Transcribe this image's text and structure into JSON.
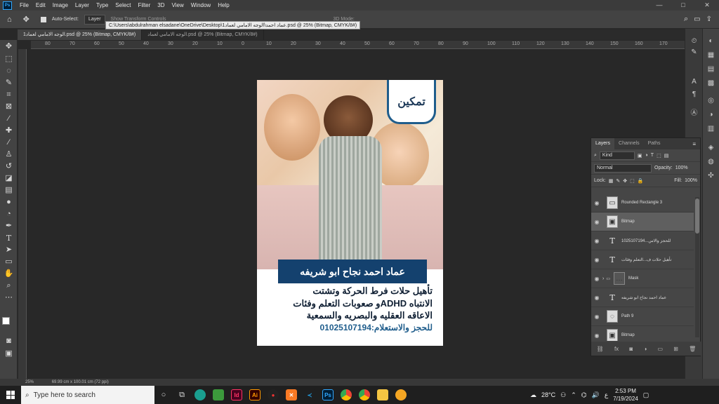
{
  "menu": {
    "app_icon": "Ps",
    "items": [
      "File",
      "Edit",
      "Image",
      "Layer",
      "Type",
      "Select",
      "Filter",
      "3D",
      "View",
      "Window",
      "Help"
    ],
    "window_controls": [
      "—",
      "□",
      "✕"
    ]
  },
  "options_bar": {
    "auto_select_label": "Auto-Select:",
    "auto_select_value": "Layer",
    "show_transform": "Show Transform Controls",
    "mode_3d": "3D Mode:"
  },
  "tooltip": "C:\\Users\\abdulrahman elsadane\\OneDrive\\Desktop\\عماد احمد\\الوجه الامامي لعماد1.psd @ 25% (Bitmap, CMYK/8#)",
  "tabs": [
    {
      "label": "الوجه الامامي لعماد1.psd @ 25% (Bitmap, CMYK/8#)",
      "active": true
    },
    {
      "label": "الوجه الامامي لعماد.psd @ 25% (Bitmap, CMYK/8#)",
      "active": false
    }
  ],
  "ruler_ticks": [
    "80",
    "70",
    "60",
    "50",
    "40",
    "30",
    "20",
    "10",
    "0",
    "10",
    "20",
    "30",
    "40",
    "50",
    "60",
    "70",
    "80",
    "90",
    "100",
    "110",
    "120",
    "130",
    "140",
    "150",
    "160",
    "170"
  ],
  "document": {
    "logo_text": "تمكين",
    "name_band": "عماد احمد نجاح ابو شريفه",
    "body_lines": [
      "تأهيل حلات فرط الحركة وتشتت",
      "الانتباه ADHDو صعوبات التعلم وفئات",
      "الاعاقه العقليه والبصريه والسمعية"
    ],
    "contact": "للحجز والاستعلام:01025107194"
  },
  "layers_panel": {
    "tabs": [
      "Layers",
      "Channels",
      "Paths"
    ],
    "filter_kind": "Kind",
    "blend_mode": "Normal",
    "opacity_label": "Opacity:",
    "opacity_value": "100%",
    "lock_label": "Lock:",
    "fill_label": "Fill:",
    "fill_value": "100%",
    "layers": [
      {
        "name": "Rounded Rectangle 3",
        "type": "shape",
        "selected": false
      },
      {
        "name": "Bitmap",
        "type": "image",
        "selected": true
      },
      {
        "name": "للحجز والاس...1025107194",
        "type": "text",
        "selected": false
      },
      {
        "name": "تأهيل حلات ف...التعلم وفئات",
        "type": "text",
        "selected": false
      },
      {
        "name": "Mask",
        "type": "group",
        "selected": false
      },
      {
        "name": "عماد احمد نجاح ابو شريفه",
        "type": "text",
        "selected": false
      },
      {
        "name": "Path 9",
        "type": "shape",
        "selected": false
      },
      {
        "name": "Bitmap",
        "type": "image",
        "selected": false
      }
    ]
  },
  "status_bar": {
    "zoom": "25%",
    "doc_size": "69.99 cm x 100.01 cm (72 ppi)"
  },
  "taskbar": {
    "search_placeholder": "Type here to search",
    "weather": "28°C",
    "lang": "ع",
    "time": "2:53 PM",
    "date": "7/19/2024"
  }
}
